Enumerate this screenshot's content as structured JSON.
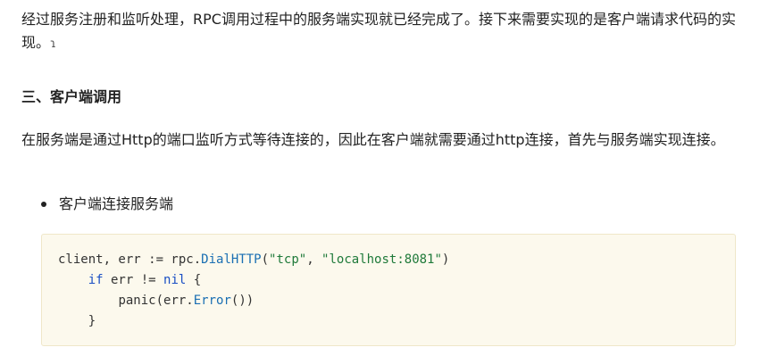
{
  "paragraphs": {
    "intro": "经过服务注册和监听处理，RPC调用过程中的服务端实现就已经完成了。接下来需要实现的是客户端请求代码的实现。",
    "section_heading": "三、客户端调用",
    "connect_desc": "在服务端是通过Http的端口监听方式等待连接的，因此在客户端就需要通过http连接，首先与服务端实现连接。"
  },
  "bullets": [
    "客户端连接服务端"
  ],
  "code": {
    "line1": {
      "a": "client, err := rpc.",
      "fn": "DialHTTP",
      "b": "(",
      "s1": "\"tcp\"",
      "c": ", ",
      "s2": "\"localhost:8081\"",
      "d": ")"
    },
    "line2": {
      "indent": "    ",
      "kw": "if",
      "a": " err != ",
      "nil": "nil",
      "b": " {"
    },
    "line3": {
      "indent": "        ",
      "a": "panic(err.",
      "fn": "Error",
      "b": "())"
    },
    "line4": {
      "indent": "    ",
      "a": "}"
    }
  }
}
